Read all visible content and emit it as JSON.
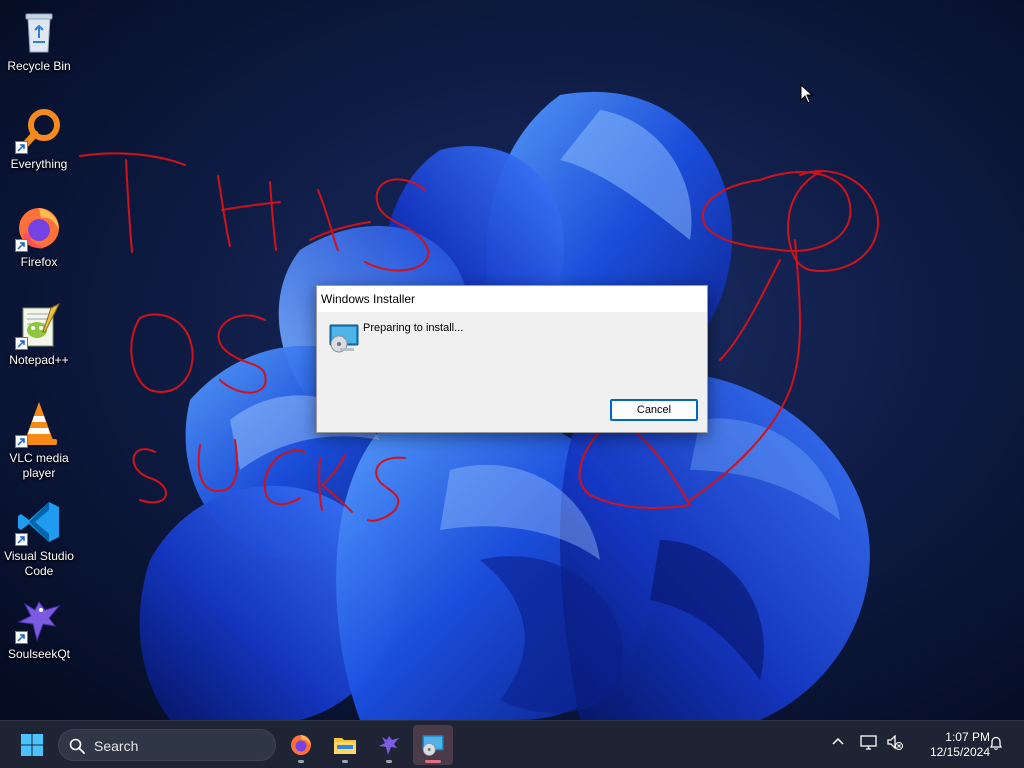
{
  "desktop": {
    "icons": [
      {
        "label": "Recycle Bin",
        "icon": "recycle-bin-icon"
      },
      {
        "label": "Everything",
        "icon": "everything-search-icon"
      },
      {
        "label": "Firefox",
        "icon": "firefox-icon"
      },
      {
        "label": "Notepad++",
        "icon": "notepadplusplus-icon"
      },
      {
        "label": "VLC media player",
        "icon": "vlc-icon"
      },
      {
        "label": "Visual Studio Code",
        "icon": "vscode-icon"
      },
      {
        "label": "SoulseekQt",
        "icon": "soulseek-icon"
      }
    ],
    "accent": "#1b4fe0"
  },
  "dialog": {
    "title": "Windows Installer",
    "message": "Preparing to install...",
    "cancel_label": "Cancel"
  },
  "taskbar": {
    "search_placeholder": "Search",
    "pinned": [
      "firefox-icon",
      "file-explorer-icon",
      "soulseek-icon",
      "windows-installer-icon"
    ],
    "active": "windows-installer-icon",
    "clock_time": "1:07 PM",
    "clock_date": "12/15/2024"
  }
}
